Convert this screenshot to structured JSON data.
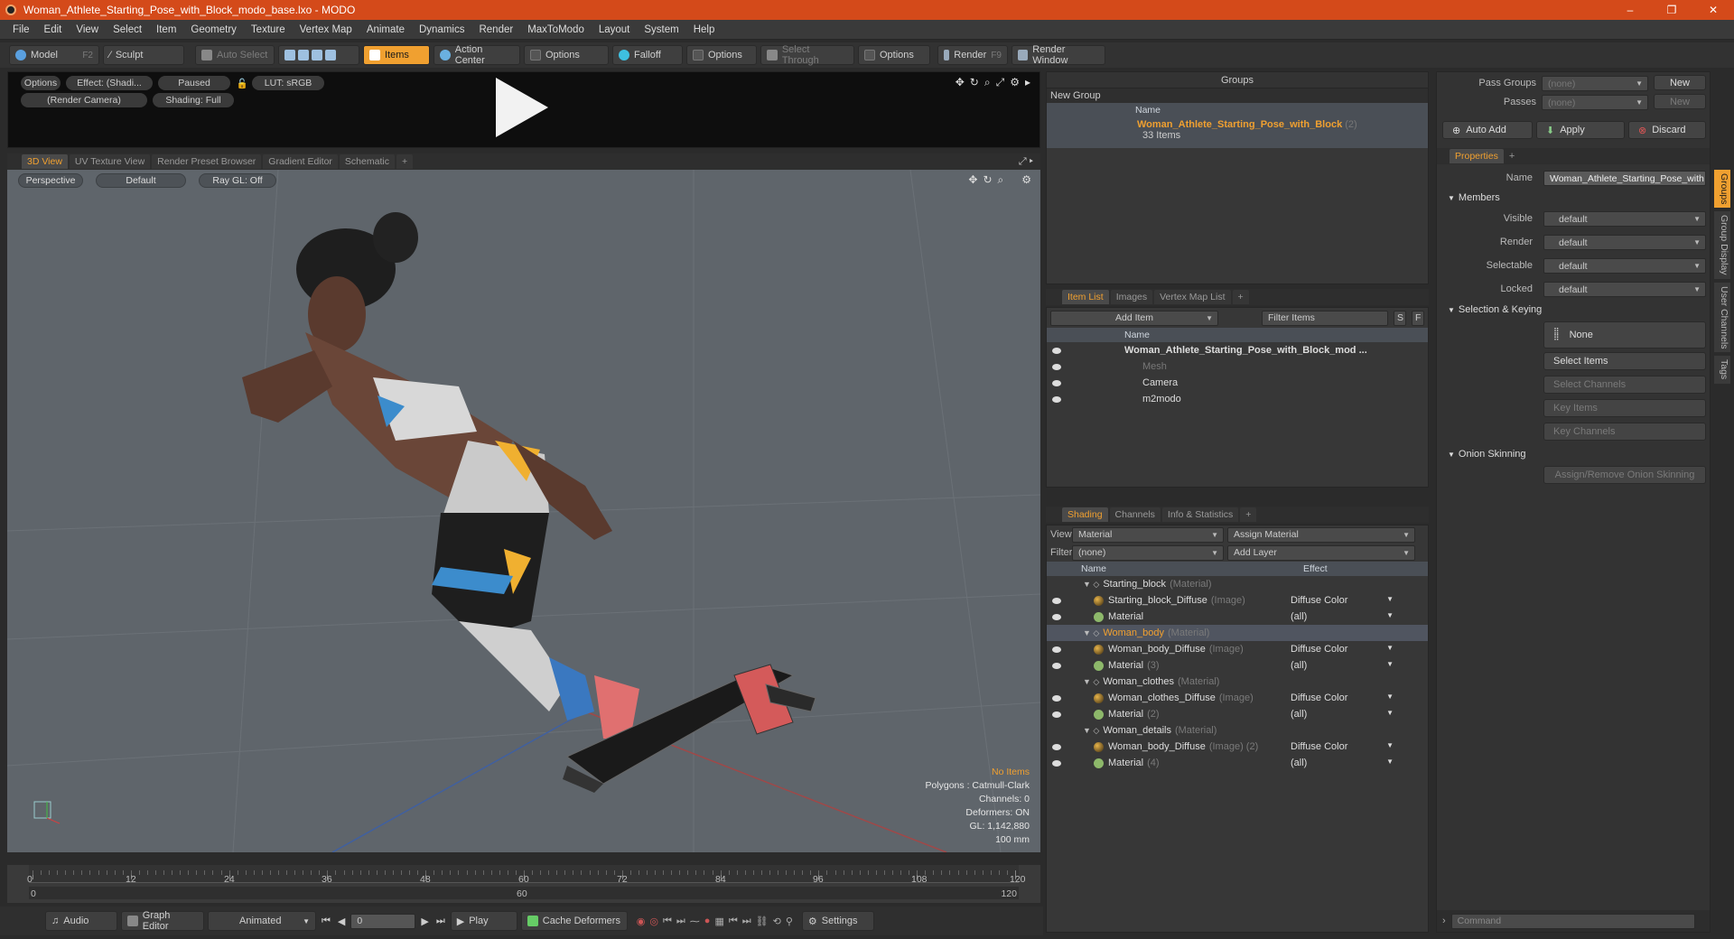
{
  "window": {
    "title": "Woman_Athlete_Starting_Pose_with_Block_modo_base.lxo - MODO",
    "min": "–",
    "max": "❐",
    "close": "✕"
  },
  "menu": [
    "File",
    "Edit",
    "View",
    "Select",
    "Item",
    "Geometry",
    "Texture",
    "Vertex Map",
    "Animate",
    "Dynamics",
    "Render",
    "MaxToModo",
    "Layout",
    "System",
    "Help"
  ],
  "toolbar": {
    "model": "Model",
    "model_key": "F2",
    "sculpt": "Sculpt",
    "auto_select": "Auto Select",
    "items": "Items",
    "action_center": "Action Center",
    "options1": "Options",
    "falloff": "Falloff",
    "options2": "Options",
    "select_through": "Select Through",
    "options3": "Options",
    "render": "Render",
    "render_key": "F9",
    "render_window": "Render Window"
  },
  "preview": {
    "options": "Options",
    "effect": "Effect: (Shadi...",
    "paused": "Paused",
    "lut": "LUT: sRGB",
    "camera": "(Render Camera)",
    "shading": "Shading: Full"
  },
  "view_tabs": [
    "3D View",
    "UV Texture View",
    "Render Preset Browser",
    "Gradient Editor",
    "Schematic",
    "+"
  ],
  "viewport": {
    "perspective": "Perspective",
    "default": "Default",
    "raygl": "Ray GL: Off",
    "stats": {
      "no_items": "No Items",
      "polygons": "Polygons : Catmull-Clark",
      "channels": "Channels: 0",
      "deformers": "Deformers: ON",
      "gl": "GL: 1,142,880",
      "scale": "100 mm"
    }
  },
  "timeline": {
    "ticks": [
      "0",
      "12",
      "24",
      "36",
      "48",
      "60",
      "72",
      "84",
      "96",
      "108",
      "120"
    ],
    "start": "0",
    "mid": "60",
    "end": "120",
    "end2": "120"
  },
  "bottom": {
    "audio": "Audio",
    "graph_editor": "Graph Editor",
    "animated": "Animated",
    "frame": "0",
    "play": "Play",
    "cache": "Cache Deformers",
    "settings": "Settings"
  },
  "groups": {
    "title": "Groups",
    "new_group": "New Group",
    "col_name": "Name",
    "item": "Woman_Athlete_Starting_Pose_with_Block",
    "item_count": "(2)",
    "item_sub": "33 Items"
  },
  "itemlist": {
    "tabs": [
      "Item List",
      "Images",
      "Vertex Map List",
      "+"
    ],
    "add_item": "Add Item",
    "filter": "Filter Items",
    "col_name": "Name",
    "rows": [
      {
        "label": "Woman_Athlete_Starting_Pose_with_Block_mod ...",
        "bold": true
      },
      {
        "label": "Mesh",
        "dim": true
      },
      {
        "label": "Camera"
      },
      {
        "label": "m2modo"
      }
    ]
  },
  "shading": {
    "tabs": [
      "Shading",
      "Channels",
      "Info & Statistics",
      "+"
    ],
    "view_label": "View",
    "view_value": "Material",
    "assign": "Assign Material",
    "filter_label": "Filter",
    "filter_value": "(none)",
    "add_layer": "Add Layer",
    "col_name": "Name",
    "col_effect": "Effect",
    "rows": [
      {
        "name": "Starting_block",
        "tag": "(Material)",
        "effect": "",
        "level": 0
      },
      {
        "name": "Starting_block_Diffuse",
        "tag": "(Image)",
        "effect": "Diffuse Color",
        "level": 1,
        "img": true
      },
      {
        "name": "Material",
        "tag": "",
        "effect": "(all)",
        "level": 1
      },
      {
        "name": "Woman_body",
        "tag": "(Material)",
        "effect": "",
        "level": 0,
        "sel": true
      },
      {
        "name": "Woman_body_Diffuse",
        "tag": "(Image)",
        "effect": "Diffuse Color",
        "level": 1,
        "img": true
      },
      {
        "name": "Material",
        "tag": "(3)",
        "effect": "(all)",
        "level": 1
      },
      {
        "name": "Woman_clothes",
        "tag": "(Material)",
        "effect": "",
        "level": 0
      },
      {
        "name": "Woman_clothes_Diffuse",
        "tag": "(Image)",
        "effect": "Diffuse Color",
        "level": 1,
        "img": true
      },
      {
        "name": "Material",
        "tag": "(2)",
        "effect": "(all)",
        "level": 1
      },
      {
        "name": "Woman_details",
        "tag": "(Material)",
        "effect": "",
        "level": 0
      },
      {
        "name": "Woman_body_Diffuse",
        "tag": "(Image) (2)",
        "effect": "Diffuse Color",
        "level": 1,
        "img": true
      },
      {
        "name": "Material",
        "tag": "(4)",
        "effect": "(all)",
        "level": 1
      }
    ]
  },
  "props": {
    "pass_groups": "Pass Groups",
    "pass_groups_val": "(none)",
    "passes": "Passes",
    "passes_val": "(none)",
    "new": "New",
    "new2": "New",
    "auto_add": "Auto Add",
    "apply": "Apply",
    "discard": "Discard",
    "tab": "Properties",
    "name_label": "Name",
    "name_value": "Woman_Athlete_Starting_Pose_with",
    "members": "Members",
    "visible": "Visible",
    "render": "Render",
    "selectable": "Selectable",
    "locked": "Locked",
    "default": "default",
    "sel_keying": "Selection & Keying",
    "none": "None",
    "select_items": "Select Items",
    "select_channels": "Select Channels",
    "key_items": "Key Items",
    "key_channels": "Key Channels",
    "onion": "Onion Skinning",
    "assign_onion": "Assign/Remove Onion Skinning",
    "command": "Command",
    "vtabs": [
      "Groups",
      "Group Display",
      "User Channels",
      "Tags"
    ]
  }
}
